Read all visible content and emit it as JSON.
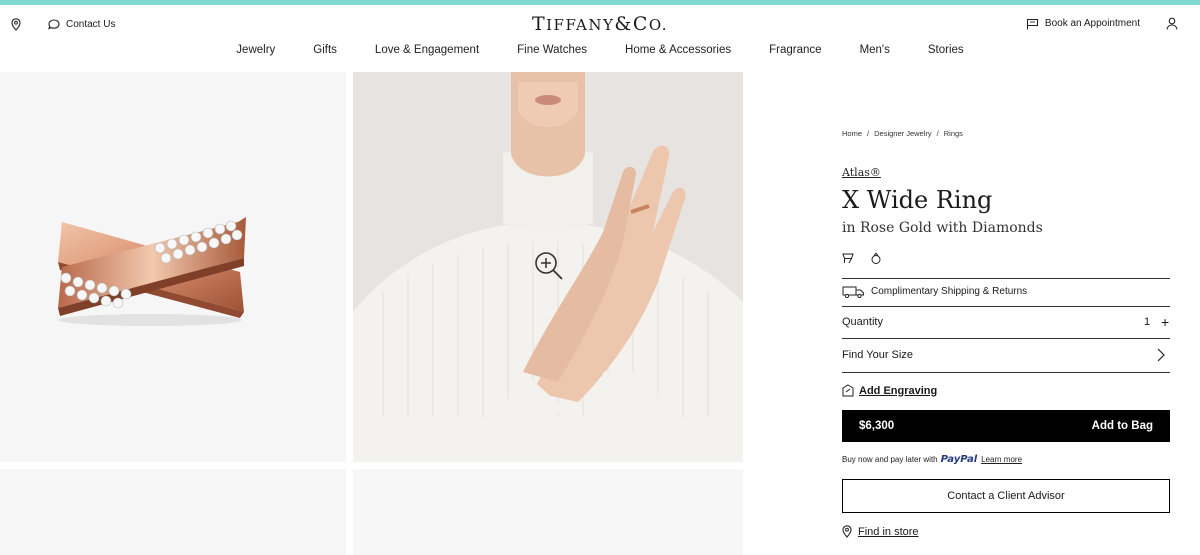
{
  "colors": {
    "accent_strip": "#81d8d0",
    "buy_button": "#000000",
    "paypal_blue": "#253b80"
  },
  "utility_bar": {
    "location_icon": "map-pin-icon",
    "contact_icon": "chat-bubble-icon",
    "contact_label": "Contact Us",
    "logo_text": "TIFFANY & CO.",
    "appointment_icon": "flag-icon",
    "appointment_label": "Book an Appointment",
    "account_icon": "user-icon"
  },
  "main_nav": {
    "items": [
      "Jewelry",
      "Gifts",
      "Love & Engagement",
      "Fine Watches",
      "Home & Accessories",
      "Fragrance",
      "Men's",
      "Stories"
    ]
  },
  "gallery": {
    "zoom_icon": "zoom-in-icon"
  },
  "product": {
    "breadcrumb": [
      "Home",
      "Designer Jewelry",
      "Rings"
    ],
    "breadcrumb_separator": "/",
    "collection": "Atlas®",
    "title": "X Wide Ring",
    "subtitle": "in Rose Gold with Diamonds",
    "attribute_icons": [
      "box-icon",
      "ring-size-icon"
    ],
    "shipping": {
      "icon": "truck-icon",
      "label": "Complimentary Shipping & Returns"
    },
    "quantity": {
      "label": "Quantity",
      "value": "1",
      "increment": "+"
    },
    "size": {
      "label": "Find Your Size",
      "icon": "chevron-right-icon"
    },
    "engraving": {
      "icon": "engrave-icon",
      "label": "Add Engraving"
    },
    "buy": {
      "price": "$6,300",
      "cta": "Add to Bag"
    },
    "paypal": {
      "prefix": "Buy now and pay later with",
      "brand": "PayPal",
      "link": "Learn more"
    },
    "advisor_label": "Contact a Client Advisor",
    "find_store": {
      "icon": "map-pin-icon",
      "label": "Find in store"
    }
  }
}
